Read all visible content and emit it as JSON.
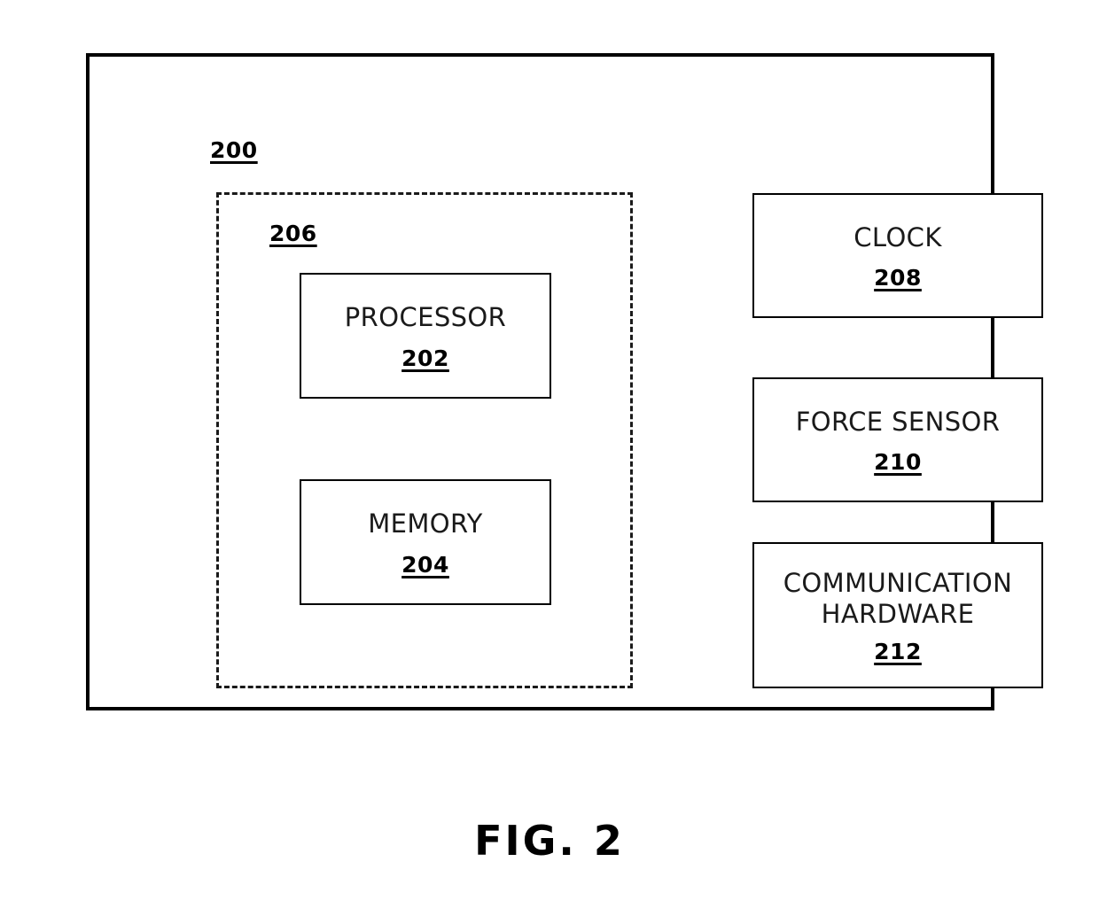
{
  "figure": {
    "caption": "FIG. 2",
    "apparatus_ref": "200",
    "subsystem_ref": "206",
    "accent_color": "#000000",
    "background_color": "#ffffff"
  },
  "blocks": [
    {
      "id": "processor",
      "title": "PROCESSOR",
      "ref": "202"
    },
    {
      "id": "memory",
      "title": "MEMORY",
      "ref": "204"
    },
    {
      "id": "clock",
      "title": "CLOCK",
      "ref": "208"
    },
    {
      "id": "force_sensor",
      "title": "FORCE SENSOR",
      "ref": "210"
    },
    {
      "id": "communication_hardware",
      "title": "COMMUNICATION\nHARDWARE",
      "ref": "212"
    }
  ]
}
